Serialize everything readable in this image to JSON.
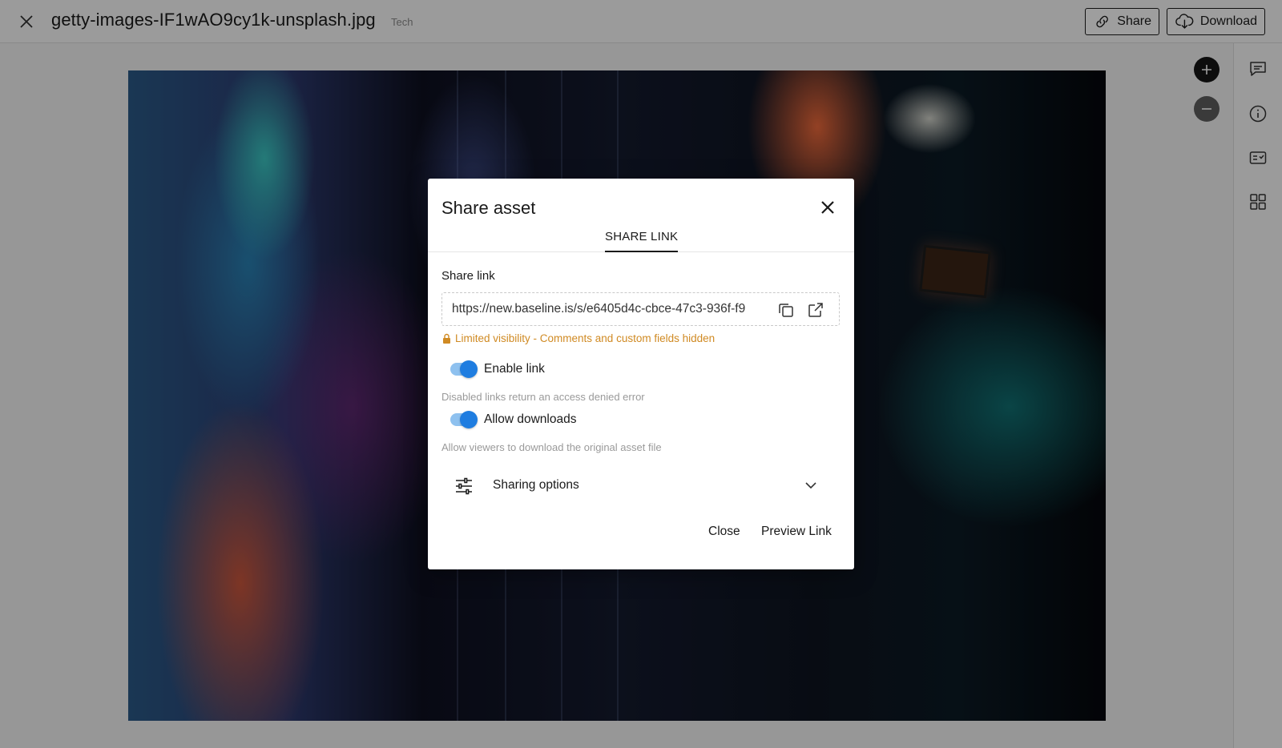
{
  "header": {
    "file_name": "getty-images-IF1wAO9cy1k-unsplash.jpg",
    "tag": "Tech",
    "share_label": "Share",
    "download_label": "Download"
  },
  "viewer": {
    "zoom_in_icon": "plus-icon",
    "zoom_out_icon": "minus-icon"
  },
  "rail": {
    "icons": [
      "comment-icon",
      "info-icon",
      "custom-fields-icon",
      "grid-icon"
    ]
  },
  "modal": {
    "title": "Share asset",
    "tab_label": "SHARE LINK",
    "share_link_label": "Share link",
    "link_value": "https://new.baseline.is/s/e6405d4c-cbce-47c3-936f-f9",
    "visibility_note": "Limited visibility - Comments and custom fields hidden",
    "enable_link": {
      "label": "Enable link",
      "helper": "Disabled links return an access denied error",
      "enabled": true
    },
    "allow_downloads": {
      "label": "Allow downloads",
      "helper": "Allow viewers to download the original asset file",
      "enabled": true
    },
    "sharing_options_label": "Sharing options",
    "close_label": "Close",
    "preview_label": "Preview Link",
    "colors": {
      "toggle_track": "#8ec1ef",
      "toggle_knob": "#1f7de0",
      "warning": "#d08a23"
    }
  }
}
